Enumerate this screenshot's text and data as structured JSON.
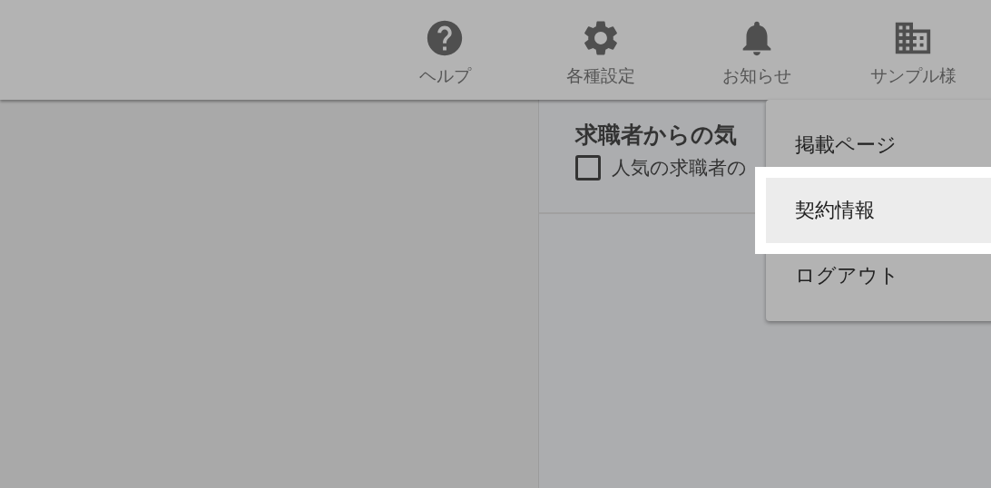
{
  "header": {
    "nav": [
      {
        "kind": "help",
        "label": "ヘルプ"
      },
      {
        "kind": "settings",
        "label": "各種設定"
      },
      {
        "kind": "notifications",
        "label": "お知らせ"
      },
      {
        "kind": "company",
        "label": "サンプル様"
      }
    ]
  },
  "panel": {
    "title": "求職者からの気",
    "filter": {
      "label": "人気の求職者の",
      "checked": false
    }
  },
  "menu": {
    "items": [
      {
        "label": "掲載ページ",
        "selected": false
      },
      {
        "label": "契約情報",
        "selected": true
      },
      {
        "label": "ログアウト",
        "selected": false
      }
    ]
  }
}
